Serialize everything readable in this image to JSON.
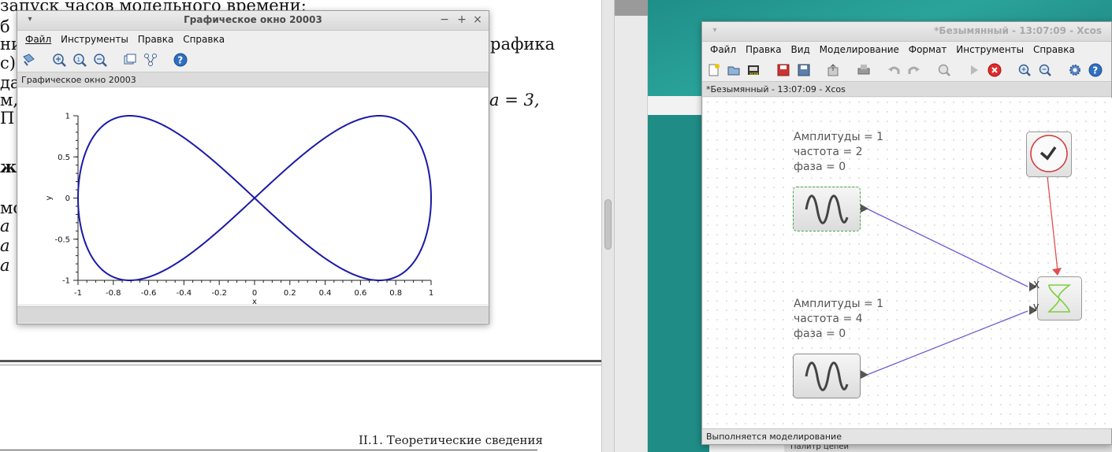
{
  "document": {
    "line1": "запуск часов модельного времени;",
    "line2a": "б",
    "line2b": "ни",
    "line2c": "рафика",
    "line3": "c);",
    "line4": "да",
    "line5a": "м,",
    "line5b": "a = 3,",
    "line6": "П",
    "line7": "ж",
    "line8": "мо",
    "line9": "a =",
    "line10": "a =",
    "line11": "a =",
    "footer": "II.1. Теоретические сведения"
  },
  "graphic_window": {
    "title": "Графическое окно 20003",
    "controls": {
      "minimize": "−",
      "maximize": "+",
      "close": "×"
    },
    "menu": [
      "Файл",
      "Инструменты",
      "Правка",
      "Справка"
    ],
    "toolbar_icons": [
      "rotate-icon",
      "zoom-in-icon",
      "zoom-reset-icon",
      "zoom-out-icon",
      "datatip-icon",
      "editor-icon",
      "help-icon"
    ],
    "header": "Графическое окно 20003",
    "status": ""
  },
  "chart_data": {
    "type": "line",
    "xlabel": "x",
    "ylabel": "y",
    "xlim": [
      -1,
      1
    ],
    "ylim": [
      -1,
      1
    ],
    "x_ticks": [
      "-1",
      "-0.8",
      "-0.6",
      "-0.4",
      "-0.2",
      "0",
      "0.2",
      "0.4",
      "0.6",
      "0.8",
      "1"
    ],
    "y_ticks": [
      "1",
      "0.5",
      "0",
      "-0.5",
      "-1"
    ],
    "series": [
      {
        "x_function": "sin(2t)",
        "y_function": "sin(4t)",
        "color": "#1a1aa6"
      }
    ],
    "grid": false
  },
  "xcos_window": {
    "title": "*Безымянный - 13:07:09 - Xcos",
    "menu": [
      "Файл",
      "Правка",
      "Вид",
      "Моделирование",
      "Формат",
      "Инструменты",
      "Справка"
    ],
    "toolbar_icons": [
      "new-icon",
      "open-icon",
      "open-file-icon",
      "save-icon",
      "save-as-icon",
      "export-icon",
      "print-icon",
      "undo-icon",
      "redo-icon",
      "fit-icon",
      "start-icon",
      "stop-icon",
      "zoom-in-icon",
      "zoom-out-icon",
      "settings-icon",
      "help-icon"
    ],
    "header": "*Безымянный - 13:07:09 - Xcos",
    "status": "Выполняется моделирование",
    "block1": {
      "line1": "Амплитуды = 1",
      "line2": "частота = 2",
      "line3": "фаза = 0"
    },
    "block2": {
      "line1": "Амплитуды = 1",
      "line2": "частота = 4",
      "line3": "фаза = 0"
    },
    "scope_ports": {
      "x": "X",
      "y": "У"
    },
    "colors": {
      "clock_red": "#d23a3a",
      "link_blue": "#6b5fd0",
      "link_red": "#e05050",
      "scope_green": "#7ccf3c"
    }
  },
  "lower_strip": "Палитр  цепей"
}
